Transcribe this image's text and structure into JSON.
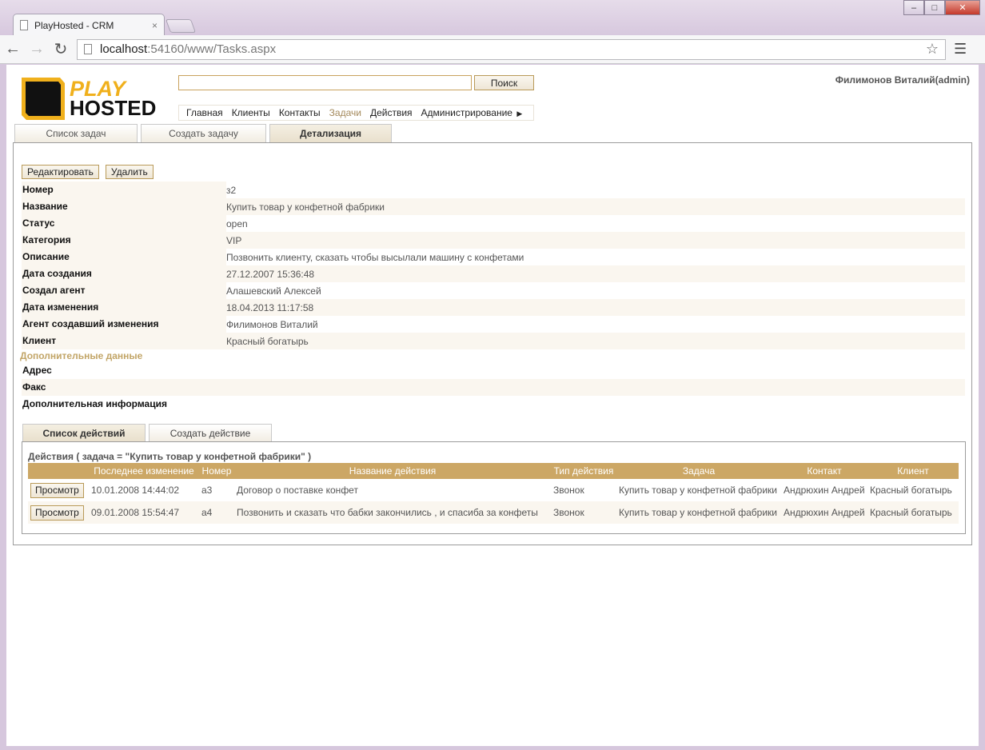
{
  "browser": {
    "tab_title": "PlayHosted - CRM",
    "tab_close": "×",
    "url_host": "localhost",
    "url_rest": ":54160/www/Tasks.aspx"
  },
  "header": {
    "logo_top": "PLAY",
    "logo_bottom": "HOSTED",
    "search_value": "",
    "search_button": "Поиск",
    "user": "Филимонов Виталий(admin)"
  },
  "menu": [
    {
      "label": "Главная"
    },
    {
      "label": "Клиенты"
    },
    {
      "label": "Контакты"
    },
    {
      "label": "Задачи"
    },
    {
      "label": "Действия"
    },
    {
      "label": "Администрирование"
    }
  ],
  "tabs": [
    {
      "label": "Список задач"
    },
    {
      "label": "Создать задачу"
    },
    {
      "label": "Детализация"
    }
  ],
  "actions": {
    "edit": "Редактировать",
    "delete": "Удалить"
  },
  "details": [
    {
      "label": "Номер",
      "value": "з2"
    },
    {
      "label": "Название",
      "value": "Купить товар у конфетной фабрики"
    },
    {
      "label": "Статус",
      "value": "open"
    },
    {
      "label": "Категория",
      "value": "VIP"
    },
    {
      "label": "Описание",
      "value": "Позвонить клиенту, сказать чтобы высылали машину с конфетами"
    },
    {
      "label": "Дата создания",
      "value": "27.12.2007 15:36:48"
    },
    {
      "label": "Создал агент",
      "value": "Алашевский Алексей"
    },
    {
      "label": "Дата изменения",
      "value": "18.04.2013 11:17:58"
    },
    {
      "label": "Агент создавший изменения",
      "value": "Филимонов Виталий"
    },
    {
      "label": "Клиент",
      "value": "Красный богатырь"
    }
  ],
  "extra_title": "Дополнительные данные",
  "extra": [
    {
      "label": "Адрес",
      "value": ""
    },
    {
      "label": "Факс",
      "value": ""
    },
    {
      "label": "Дополнительная информация",
      "value": ""
    }
  ],
  "subtabs": [
    {
      "label": "Список действий"
    },
    {
      "label": "Создать действие"
    }
  ],
  "grid": {
    "caption": "Действия ( задача = \"Купить товар у конфетной фабрики\" )",
    "columns": [
      "",
      "Последнее изменение",
      "Номер",
      "Название действия",
      "Тип действия",
      "Задача",
      "Контакт",
      "Клиент"
    ],
    "view_button": "Просмотр",
    "rows": [
      {
        "changed": "10.01.2008 14:44:02",
        "number": "а3",
        "name": "Договор о поставке конфет",
        "type": "Звонок",
        "task": "Купить товар у конфетной фабрики",
        "contact": "Андрюхин Андрей",
        "client": "Красный богатырь"
      },
      {
        "changed": "09.01.2008 15:54:47",
        "number": "а4",
        "name": "Позвонить и сказать что бабки закончились , и спасиба за конфеты",
        "type": "Звонок",
        "task": "Купить товар у конфетной фабрики",
        "contact": "Андрюхин Андрей",
        "client": "Красный богатырь"
      }
    ]
  }
}
